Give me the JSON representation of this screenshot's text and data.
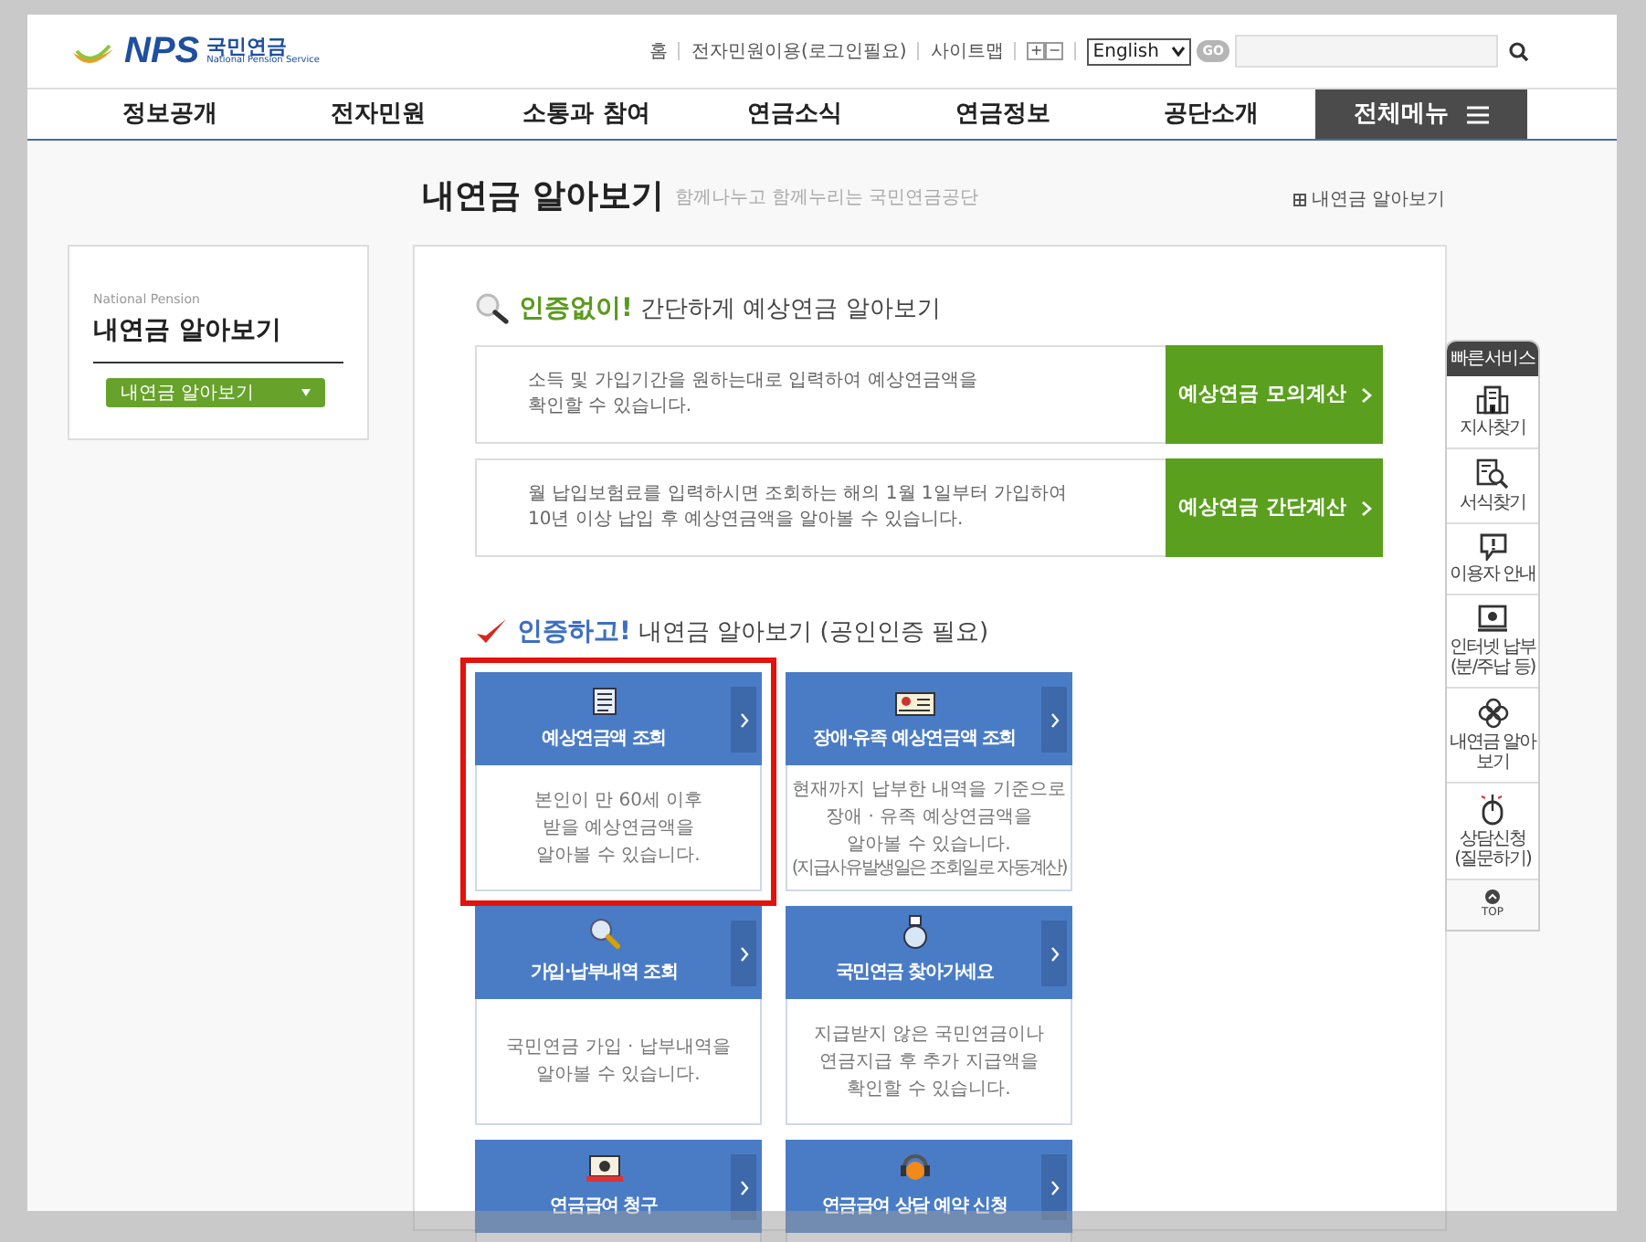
{
  "logo": {
    "mark": "NPS",
    "name": "국민연금",
    "tagline": "National Pension Service"
  },
  "top_links": [
    "홈",
    "전자민원이용(로그인필요)",
    "사이트맵"
  ],
  "font_size_buttons": [
    "+",
    "−"
  ],
  "language_select": {
    "value": "English"
  },
  "go_button": "GO",
  "nav": [
    "정보공개",
    "전자민원",
    "소통과 참여",
    "연금소식",
    "연금정보",
    "공단소개"
  ],
  "all_menu": "전체메뉴",
  "page_title": "내연금 알아보기",
  "page_subtitle": "함께나누고 함께누리는 국민연금공단",
  "breadcrumb": "내연금 알아보기",
  "side_panel": {
    "eyebrow": "National Pension",
    "title": "내연금 알아보기",
    "menu_button": "내연금 알아보기"
  },
  "section_no_auth": {
    "highlight": "인증없이!",
    "title": "간단하게 예상연금 알아보기",
    "rows": [
      {
        "description": [
          "소득 및 가입기간을 원하는대로 입력하여 예상연금액을",
          "확인할 수 있습니다."
        ],
        "button": "예상연금 모의계산"
      },
      {
        "description": [
          "월 납입보험료를 입력하시면 조회하는 해의 1월 1일부터 가입하여",
          "10년 이상 납입 후 예상연금액을 알아볼 수 있습니다."
        ],
        "button": "예상연금 간단계산"
      }
    ]
  },
  "section_auth": {
    "highlight": "인증하고!",
    "title": "내연금 알아보기 (공인인증 필요)",
    "card_rows": [
      [
        {
          "title": "예상연금액 조회",
          "description": [
            "본인이 만 60세 이후",
            "받을 예상연금액을",
            "알아볼 수 있습니다."
          ],
          "highlighted": true
        },
        {
          "title": "장애·유족 예상연금액 조회",
          "description": [
            "현재까지 납부한 내역을 기준으로",
            "장애 · 유족 예상연금액을",
            "알아볼 수 있습니다."
          ],
          "note": "(지급사유발생일은 조회일로 자동계산)",
          "highlighted": false
        }
      ],
      [
        {
          "title": "가입·납부내역 조회",
          "description": [
            "국민연금 가입 · 납부내역을",
            "알아볼 수 있습니다."
          ],
          "highlighted": false
        },
        {
          "title": "국민연금 찾아가세요",
          "description": [
            "지급받지 않은 국민연금이나",
            "연금지급 후 추가 지급액을",
            "확인할 수 있습니다."
          ],
          "highlighted": false
        }
      ],
      [
        {
          "title": "연금급여 청구",
          "highlighted": false
        },
        {
          "title": "연금급여 상담 예약 신청",
          "highlighted": false
        }
      ]
    ]
  },
  "quick_service": {
    "title": "빠른서비스",
    "items": [
      "지사찾기",
      "서식찾기",
      "이용자 안내",
      "인터넷 납부 (분/주납 등)",
      "내연금 알아보기",
      "상담신청 (질문하기)"
    ],
    "top": "TOP"
  }
}
